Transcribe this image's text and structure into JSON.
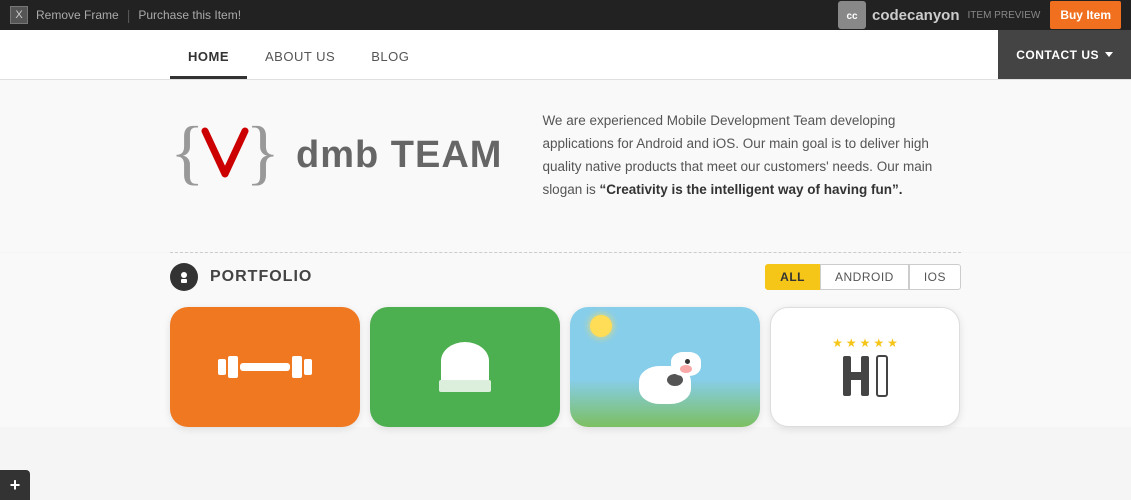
{
  "topbar": {
    "close_label": "X",
    "remove_frame": "Remove Frame",
    "separator": "|",
    "purchase_label": "Purchase this Item!",
    "logo_text": "codecanyon",
    "item_preview": "ITEM PREVIEW",
    "buy_label": "Buy Item"
  },
  "nav": {
    "items": [
      {
        "label": "HOME",
        "active": true
      },
      {
        "label": "ABOUT US",
        "active": false
      },
      {
        "label": "BLOG",
        "active": false
      }
    ],
    "contact_label": "CONTACT US"
  },
  "hero": {
    "company_name": "dmb TEAM",
    "description": "We are experienced Mobile Development Team developing applications for Android and iOS. Our main goal is to deliver high quality native products that meet our customers' needs. Our main slogan is ",
    "slogan": "“Creativity is the intelligent way of having fun”."
  },
  "portfolio": {
    "title": "PORTFOLIO",
    "filters": [
      {
        "label": "ALL",
        "active": true
      },
      {
        "label": "ANDROID",
        "active": false
      },
      {
        "label": "IOS",
        "active": false
      }
    ],
    "apps": [
      {
        "name": "fitness-app",
        "type": "orange"
      },
      {
        "name": "chef-app",
        "type": "green"
      },
      {
        "name": "cow-app",
        "type": "scene"
      },
      {
        "name": "hotel-app",
        "type": "white"
      }
    ]
  },
  "hotel": {
    "stars": [
      "★",
      "★",
      "★",
      "★",
      "★"
    ]
  }
}
